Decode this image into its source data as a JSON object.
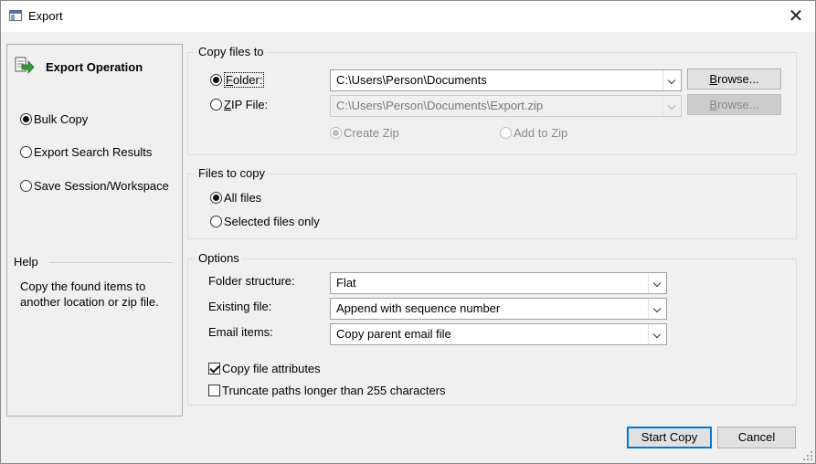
{
  "window": {
    "title": "Export",
    "close_glyph": "✕"
  },
  "left_panel": {
    "heading": "Export Operation",
    "heading_icon": "export-arrow-icon",
    "operations": [
      {
        "label": "Bulk Copy",
        "checked": true
      },
      {
        "label": "Export Search Results",
        "checked": false
      },
      {
        "label": "Save Session/Workspace",
        "checked": false
      }
    ],
    "help_title": "Help",
    "help_text": "Copy the found items to another location or zip file."
  },
  "copy_to": {
    "group_title": "Copy files to",
    "folder_label_accel": "F",
    "folder_label_rest": "older:",
    "folder_path": "C:\\Users\\Person\\Documents",
    "zip_label_accel": "Z",
    "zip_label_rest": "IP File:",
    "zip_path": "C:\\Users\\Person\\Documents\\Export.zip",
    "browse_accel": "B",
    "browse_rest": "rowse...",
    "create_zip_label": "Create Zip",
    "add_zip_label": "Add to Zip"
  },
  "files_to_copy": {
    "group_title": "Files to copy",
    "all_files_label": "All files",
    "selected_files_label": "Selected files only"
  },
  "options": {
    "group_title": "Options",
    "folder_structure_label": "Folder structure:",
    "folder_structure_value": "Flat",
    "existing_file_label": "Existing file:",
    "existing_file_value": "Append with sequence number",
    "email_items_label": "Email items:",
    "email_items_value": "Copy parent email file",
    "copy_attributes_label": "Copy file attributes",
    "copy_attributes_checked": true,
    "truncate_label": "Truncate paths longer than 255 characters",
    "truncate_checked": false
  },
  "footer": {
    "start_label": "Start Copy",
    "cancel_label": "Cancel"
  },
  "colors": {
    "accent": "#0078d7",
    "window_bg": "#f0f0f0",
    "icon_green": "#3a9a3a"
  }
}
